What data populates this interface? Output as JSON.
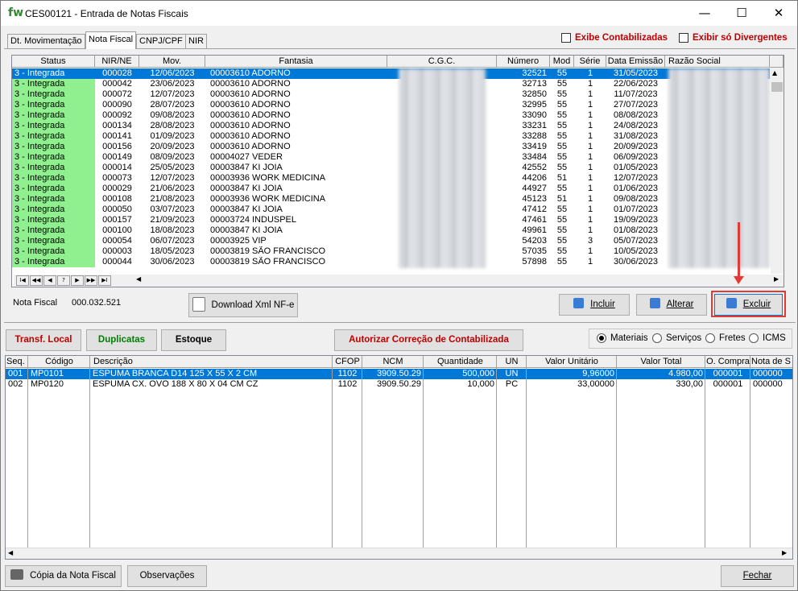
{
  "window": {
    "logo": "fw",
    "title": "CES00121 - Entrada de Notas Fiscais",
    "minimize": "—",
    "maximize": "☐",
    "close": "✕"
  },
  "tabs": [
    {
      "label": "Dt. Movimentação",
      "active": false
    },
    {
      "label": "Nota Fiscal",
      "active": true
    },
    {
      "label": "CNPJ/CPF",
      "active": false
    },
    {
      "label": "NIR",
      "active": false
    }
  ],
  "filters": {
    "exibe_contabilizadas": "Exibe Contabilizadas",
    "exibir_divergentes": "Exibir só Divergentes"
  },
  "grid": {
    "columns": [
      "Status",
      "NIR/NE",
      "Mov.",
      "Fantasia",
      "C.G.C.",
      "Número",
      "Mod",
      "Série",
      "Data Emissão",
      "Razão Social"
    ],
    "rows": [
      [
        "3 - Integrada",
        "000028",
        "12/06/2023",
        "00003610  ADORNO",
        "",
        "32521",
        "55",
        "1",
        "31/05/2023"
      ],
      [
        "3 - Integrada",
        "000042",
        "23/06/2023",
        "00003610  ADORNO",
        "",
        "32713",
        "55",
        "1",
        "22/06/2023"
      ],
      [
        "3 - Integrada",
        "000072",
        "12/07/2023",
        "00003610  ADORNO",
        "",
        "32850",
        "55",
        "1",
        "11/07/2023"
      ],
      [
        "3 - Integrada",
        "000090",
        "28/07/2023",
        "00003610  ADORNO",
        "",
        "32995",
        "55",
        "1",
        "27/07/2023"
      ],
      [
        "3 - Integrada",
        "000092",
        "09/08/2023",
        "00003610  ADORNO",
        "",
        "33090",
        "55",
        "1",
        "08/08/2023"
      ],
      [
        "3 - Integrada",
        "000134",
        "28/08/2023",
        "00003610  ADORNO",
        "",
        "33231",
        "55",
        "1",
        "24/08/2023"
      ],
      [
        "3 - Integrada",
        "000141",
        "01/09/2023",
        "00003610  ADORNO",
        "",
        "33288",
        "55",
        "1",
        "31/08/2023"
      ],
      [
        "3 - Integrada",
        "000156",
        "20/09/2023",
        "00003610  ADORNO",
        "",
        "33419",
        "55",
        "1",
        "20/09/2023"
      ],
      [
        "3 - Integrada",
        "000149",
        "08/09/2023",
        "00004027  VEDER",
        "",
        "33484",
        "55",
        "1",
        "06/09/2023"
      ],
      [
        "3 - Integrada",
        "000014",
        "25/05/2023",
        "00003847  KI JOIA",
        "",
        "42552",
        "55",
        "1",
        "01/05/2023"
      ],
      [
        "3 - Integrada",
        "000073",
        "12/07/2023",
        "00003936  WORK MEDICINA",
        "",
        "44206",
        "51",
        "1",
        "12/07/2023"
      ],
      [
        "3 - Integrada",
        "000029",
        "21/06/2023",
        "00003847  KI JOIA",
        "",
        "44927",
        "55",
        "1",
        "01/06/2023"
      ],
      [
        "3 - Integrada",
        "000108",
        "21/08/2023",
        "00003936  WORK MEDICINA",
        "",
        "45123",
        "51",
        "1",
        "09/08/2023"
      ],
      [
        "3 - Integrada",
        "000050",
        "03/07/2023",
        "00003847  KI JOIA",
        "",
        "47412",
        "55",
        "1",
        "01/07/2023"
      ],
      [
        "3 - Integrada",
        "000157",
        "21/09/2023",
        "00003724  INDUSPEL",
        "",
        "47461",
        "55",
        "1",
        "19/09/2023"
      ],
      [
        "3 - Integrada",
        "000100",
        "18/08/2023",
        "00003847  KI JOIA",
        "",
        "49961",
        "55",
        "1",
        "01/08/2023"
      ],
      [
        "3 - Integrada",
        "000054",
        "06/07/2023",
        "00003925  VIP",
        "",
        "54203",
        "55",
        "3",
        "05/07/2023"
      ],
      [
        "3 - Integrada",
        "000003",
        "18/05/2023",
        "00003819  SÃO FRANCISCO",
        "",
        "57035",
        "55",
        "1",
        "10/05/2023"
      ],
      [
        "3 - Integrada",
        "000044",
        "30/06/2023",
        "00003819  SÃO FRANCISCO",
        "",
        "57898",
        "55",
        "1",
        "30/06/2023"
      ]
    ],
    "navigator": [
      "I◀",
      "◀◀",
      "◀",
      "?",
      "▶",
      "▶▶",
      "▶I"
    ]
  },
  "nota_fiscal": {
    "label": "Nota Fiscal",
    "value": "000.032.521"
  },
  "buttons": {
    "download_xml": "Download Xml NF-e",
    "incluir": "Incluir",
    "alterar": "Alterar",
    "excluir": "Excluir",
    "transf_local": "Transf. Local",
    "duplicatas": "Duplicatas",
    "estoque": "Estoque",
    "autorizar": "Autorizar Correção de Contabilizada",
    "copia": "Cópia da Nota Fiscal",
    "observacoes": "Observações",
    "fechar": "Fechar"
  },
  "radios": [
    "Materiais",
    "Serviços",
    "Fretes",
    "ICMS"
  ],
  "items": {
    "columns": [
      "Seq.",
      "Código",
      "Descrição",
      "CFOP",
      "NCM",
      "Quantidade",
      "UN",
      "Valor Unitário",
      "Valor Total",
      "O. Compra",
      "Nota  de S"
    ],
    "rows": [
      [
        "001",
        "MP0101",
        "ESPUMA BRANCA D14 125 X 55 X 2 CM",
        "1102",
        "3909.50.29",
        "500,000",
        "UN",
        "9,96000",
        "4.980,00",
        "000001",
        "000000"
      ],
      [
        "002",
        "MP0120",
        "ESPUMA CX. OVO 188 X 80 X 04 CM CZ",
        "1102",
        "3909.50.29",
        "10,000",
        "PC",
        "33,00000",
        "330,00",
        "000001",
        "000000"
      ]
    ]
  },
  "colors": {
    "status_green": "#90f090",
    "selection": "#0078d7",
    "highlight": "#e53935",
    "red_text": "#c00000",
    "green_text": "#008000"
  }
}
